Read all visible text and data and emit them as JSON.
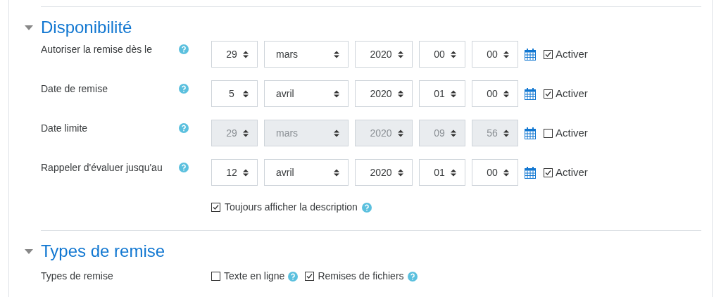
{
  "sections": [
    {
      "title": "Disponibilité",
      "expanded": true,
      "date_rows": [
        {
          "label": "Autoriser la remise dès le",
          "disabled": false,
          "day": "29",
          "month": "mars",
          "year": "2020",
          "hour": "00",
          "minute": "00",
          "enable_label": "Activer",
          "checked": true
        },
        {
          "label": "Date de remise",
          "disabled": false,
          "day": "5",
          "month": "avril",
          "year": "2020",
          "hour": "01",
          "minute": "00",
          "enable_label": "Activer",
          "checked": true
        },
        {
          "label": "Date limite",
          "disabled": true,
          "day": "29",
          "month": "mars",
          "year": "2020",
          "hour": "09",
          "minute": "56",
          "enable_label": "Activer",
          "checked": false
        },
        {
          "label": "Rappeler d'évaluer jusqu'au",
          "disabled": false,
          "day": "12",
          "month": "avril",
          "year": "2020",
          "hour": "01",
          "minute": "00",
          "enable_label": "Activer",
          "checked": true
        }
      ],
      "options": [
        {
          "label": "Toujours afficher la description",
          "checked": true
        }
      ]
    },
    {
      "title": "Types de remise",
      "expanded": true,
      "type_row": {
        "label": "Types de remise",
        "options": [
          {
            "label": "Texte en ligne",
            "checked": false
          },
          {
            "label": "Remises de fichiers",
            "checked": true
          }
        ]
      }
    }
  ]
}
